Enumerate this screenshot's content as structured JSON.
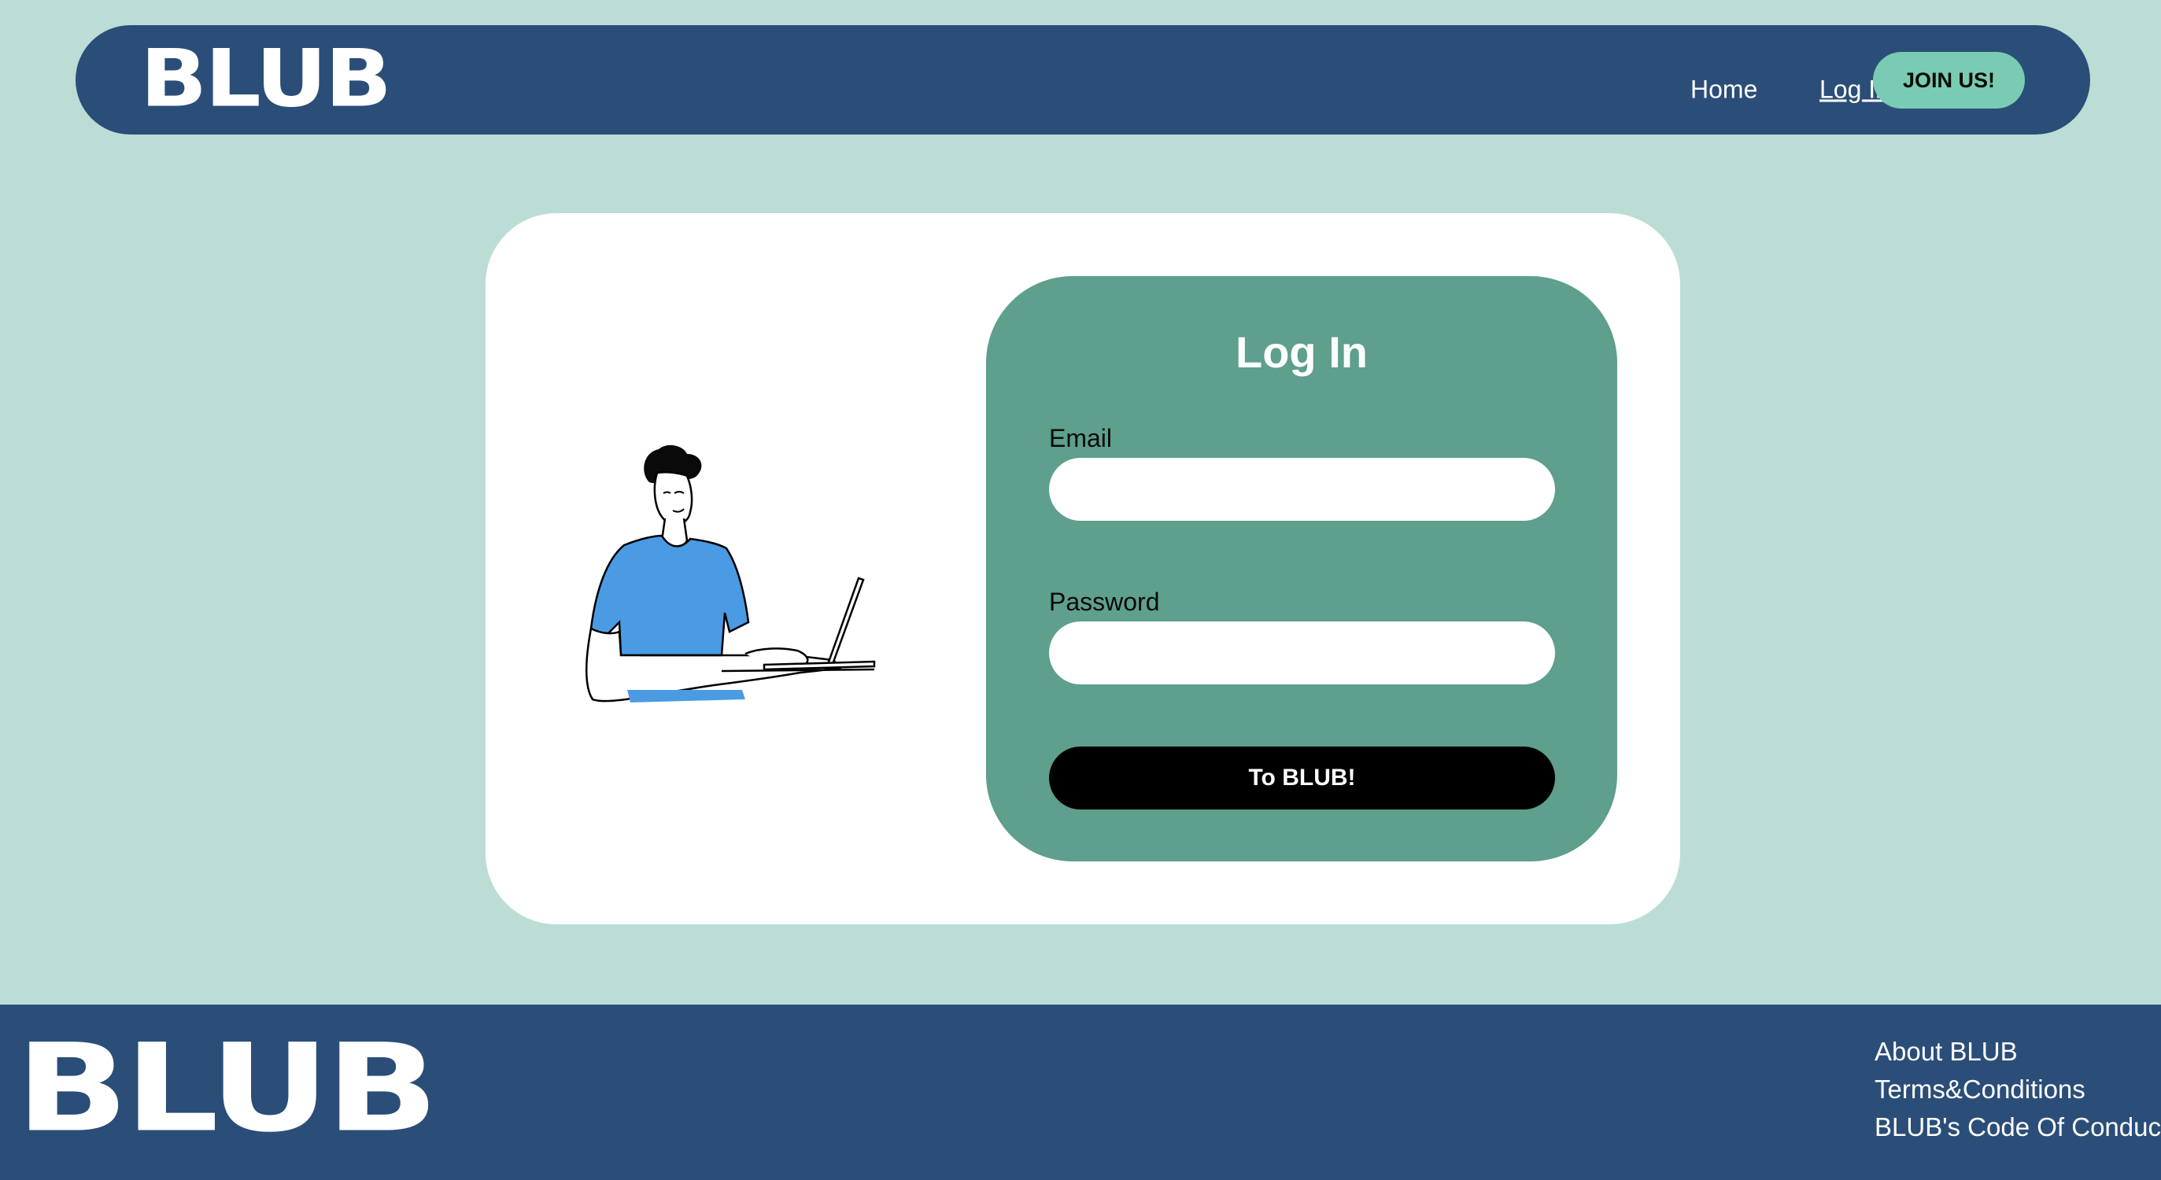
{
  "header": {
    "logo": "BLUB",
    "nav": {
      "home": "Home",
      "login": "Log In",
      "join": "JOIN US!"
    }
  },
  "login_form": {
    "title": "Log In",
    "email_label": "Email",
    "email_value": "",
    "password_label": "Password",
    "password_value": "",
    "submit_label": "To BLUB!"
  },
  "illustration": {
    "icon": "person-typing-on-laptop-illustration"
  },
  "footer": {
    "logo": "BLUB",
    "links": [
      "About BLUB",
      "Terms&Conditions",
      "BLUB's Code Of Conduct"
    ]
  },
  "colors": {
    "background": "#bcddd5",
    "navy": "#2b4e78",
    "accent_mint": "#7acbb4",
    "panel_green": "#5e9f8d",
    "shirt_blue": "#4a9be3"
  }
}
